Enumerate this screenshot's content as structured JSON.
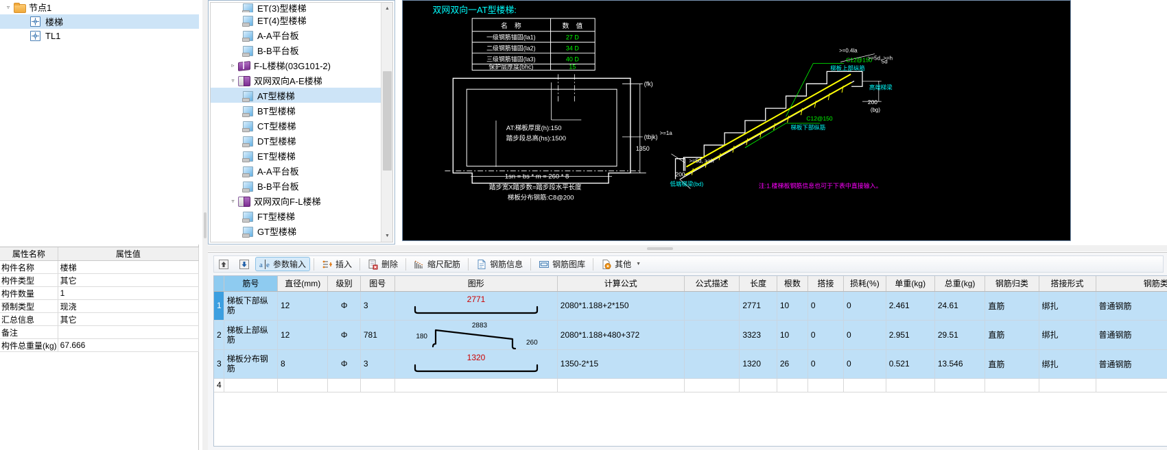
{
  "left_tree": {
    "root": {
      "label": "节点1",
      "icon": "folder-icon",
      "expander": "expanded"
    },
    "children": [
      {
        "label": "楼梯",
        "icon": "component-icon",
        "selected": true
      },
      {
        "label": "TL1",
        "icon": "component-icon",
        "selected": false
      }
    ]
  },
  "properties": {
    "headers": [
      "属性名称",
      "属性值"
    ],
    "rows": [
      {
        "name": "构件名称",
        "value": "楼梯"
      },
      {
        "name": "构件类型",
        "value": "其它"
      },
      {
        "name": "构件数量",
        "value": "1"
      },
      {
        "name": "预制类型",
        "value": "现浇"
      },
      {
        "name": "汇总信息",
        "value": "其它"
      },
      {
        "name": "备注",
        "value": ""
      },
      {
        "name": "构件总重量(kg)",
        "value": "67.666"
      }
    ]
  },
  "mid_tree": {
    "items": [
      {
        "label": "ET(3)型楼梯",
        "indent": 2,
        "icon": "sheet-icon",
        "twist": "",
        "selected": false,
        "clipped": true
      },
      {
        "label": "ET(4)型楼梯",
        "indent": 2,
        "icon": "sheet-icon",
        "twist": "",
        "selected": false
      },
      {
        "label": "A-A平台板",
        "indent": 2,
        "icon": "sheet-icon",
        "twist": "",
        "selected": false
      },
      {
        "label": "B-B平台板",
        "indent": 2,
        "icon": "sheet-icon",
        "twist": "",
        "selected": false
      },
      {
        "label": "F-L楼梯(03G101-2)",
        "indent": 1,
        "icon": "book-closed-icon",
        "twist": "collapsed",
        "selected": false
      },
      {
        "label": "双网双向A-E楼梯",
        "indent": 1,
        "icon": "book-open-icon",
        "twist": "expanded",
        "selected": false
      },
      {
        "label": "AT型楼梯",
        "indent": 2,
        "icon": "sheet-icon",
        "twist": "",
        "selected": true
      },
      {
        "label": "BT型楼梯",
        "indent": 2,
        "icon": "sheet-icon",
        "twist": "",
        "selected": false
      },
      {
        "label": "CT型楼梯",
        "indent": 2,
        "icon": "sheet-icon",
        "twist": "",
        "selected": false
      },
      {
        "label": "DT型楼梯",
        "indent": 2,
        "icon": "sheet-icon",
        "twist": "",
        "selected": false
      },
      {
        "label": "ET型楼梯",
        "indent": 2,
        "icon": "sheet-icon",
        "twist": "",
        "selected": false
      },
      {
        "label": "A-A平台板",
        "indent": 2,
        "icon": "sheet-icon",
        "twist": "",
        "selected": false
      },
      {
        "label": "B-B平台板",
        "indent": 2,
        "icon": "sheet-icon",
        "twist": "",
        "selected": false
      },
      {
        "label": "双网双向F-L楼梯",
        "indent": 1,
        "icon": "book-open-icon",
        "twist": "expanded",
        "selected": false
      },
      {
        "label": "FT型楼梯",
        "indent": 2,
        "icon": "sheet-icon",
        "twist": "",
        "selected": false
      },
      {
        "label": "GT型楼梯",
        "indent": 2,
        "icon": "sheet-icon",
        "twist": "",
        "selected": false
      }
    ]
  },
  "cad": {
    "title": "双网双向一AT型楼梯:",
    "param_table": {
      "headers": [
        "名　称",
        "数　值"
      ],
      "rows": [
        {
          "name": "一级钢筋锚固(la1)",
          "value": "27 D"
        },
        {
          "name": "二级钢筋锚固(la2)",
          "value": "34 D"
        },
        {
          "name": "三级钢筋锚固(la3)",
          "value": "40 D"
        },
        {
          "name": "保护层厚度(bhc)",
          "value": "15"
        }
      ]
    },
    "plan_labels": {
      "thickness": "AT:梯板厚度(h):150",
      "rise_total": "踏步段总高(hs):1500",
      "span_formula": "1sn = bs * m = 260 * 8",
      "note1": "踏步宽X踏步数=踏步段水平长度",
      "note2": "梯板分布钢筋:C8@200",
      "fk": "(fk)",
      "tbjk": "(tbjk)",
      "dim1350": "1350"
    },
    "section_labels": {
      "top_bar": "C12@150",
      "top_bar_desc": "梯板上部纵筋",
      "bottom_bar": "C12@150",
      "bottom_bar_desc": "梯板下部纵筋",
      "high_end": "高端梯梁",
      "low_end": "低端梯梁(bd)",
      "d200a": "200",
      "d200b": "200",
      "bg": "(bg)",
      "ge5d_a": ">=5d, >=h",
      "ge5d_b": ">=5d, >=h",
      "ge041": ">=0.4la",
      "ge1a": ">=1a",
      "fived": "5d",
      "note": "注:1.楼梯板钢筋信息也可于下表中直接输入。"
    }
  },
  "toolbar": {
    "buttons": [
      {
        "label": "",
        "icon": "move-up-icon",
        "active": false
      },
      {
        "label": "",
        "icon": "move-down-icon",
        "active": false
      },
      {
        "label": "参数输入",
        "icon": "param-input-icon",
        "active": true
      },
      {
        "label": "插入",
        "icon": "insert-row-icon",
        "active": false
      },
      {
        "label": "删除",
        "icon": "delete-row-icon",
        "active": false
      },
      {
        "label": "缩尺配筋",
        "icon": "scale-rebar-icon",
        "active": false
      },
      {
        "label": "钢筋信息",
        "icon": "rebar-info-icon",
        "active": false
      },
      {
        "label": "钢筋图库",
        "icon": "rebar-library-icon",
        "active": false
      },
      {
        "label": "其他",
        "icon": "other-icon",
        "active": false,
        "has_caret": true
      }
    ]
  },
  "grid": {
    "headers": [
      "筋号",
      "直径(mm)",
      "级别",
      "图号",
      "图形",
      "计算公式",
      "公式描述",
      "长度",
      "根数",
      "搭接",
      "损耗(%)",
      "单重(kg)",
      "总重(kg)",
      "钢筋归类",
      "搭接形式",
      "钢筋类型"
    ],
    "rows": [
      {
        "no": "1",
        "name": "梯板下部纵筋",
        "diameter": "12",
        "grade": "Φ",
        "fig_no": "3",
        "shape": {
          "type": "bottom-hook-bar",
          "top_label": "2771",
          "label_color": "#cc0000"
        },
        "formula": "2080*1.188+2*150",
        "formula_desc": "",
        "length": "2771",
        "count": "10",
        "lap": "0",
        "loss": "0",
        "unit_weight": "2.461",
        "total_weight": "24.61",
        "category": "直筋",
        "lap_form": "绑扎",
        "rebar_type": "普通钢筋"
      },
      {
        "no": "2",
        "name": "梯板上部纵筋",
        "diameter": "12",
        "grade": "Φ",
        "fig_no": "781",
        "shape": {
          "type": "z-bent-bar",
          "top_label": "2883",
          "left_label": "180",
          "right_label": "260",
          "label_color": "#000000"
        },
        "formula": "2080*1.188+480+372",
        "formula_desc": "",
        "length": "3323",
        "count": "10",
        "lap": "0",
        "loss": "0",
        "unit_weight": "2.951",
        "total_weight": "29.51",
        "category": "直筋",
        "lap_form": "绑扎",
        "rebar_type": "普通钢筋"
      },
      {
        "no": "3",
        "name": "梯板分布钢筋",
        "diameter": "8",
        "grade": "Φ",
        "fig_no": "3",
        "shape": {
          "type": "bottom-hook-bar",
          "top_label": "1320",
          "label_color": "#cc0000"
        },
        "formula": "1350-2*15",
        "formula_desc": "",
        "length": "1320",
        "count": "26",
        "lap": "0",
        "loss": "0",
        "unit_weight": "0.521",
        "total_weight": "13.546",
        "category": "直筋",
        "lap_form": "绑扎",
        "rebar_type": "普通钢筋"
      }
    ],
    "empty_row_no": "4"
  },
  "colors": {
    "selection": "#cde4f7",
    "grid_row": "#bfe0f7",
    "header_sel": "#8ecbf0",
    "cad_bg": "#000000",
    "cad_cyan": "#00ffff",
    "cad_green": "#00ff00",
    "cad_yellow": "#ffff00",
    "cad_white": "#ffffff",
    "cad_magenta": "#ff00ff"
  }
}
